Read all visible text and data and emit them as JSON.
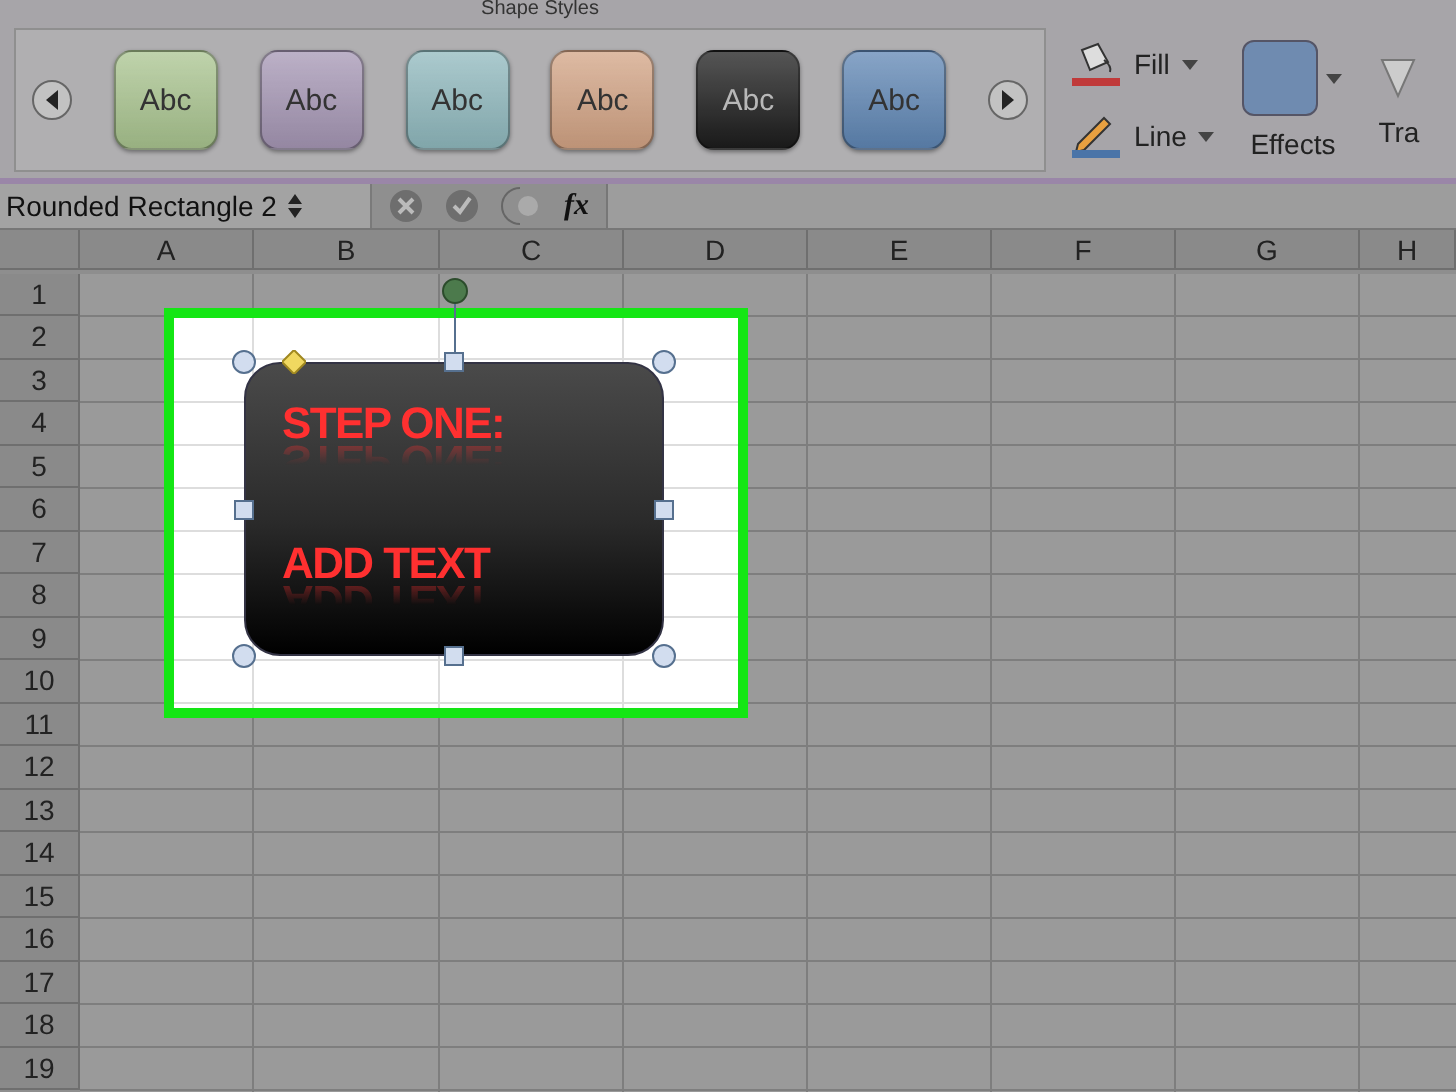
{
  "ribbon": {
    "group_title": "Shape Styles",
    "style_swatches": [
      {
        "label": "Abc",
        "color": "#a9c48f"
      },
      {
        "label": "Abc",
        "color": "#a596b4"
      },
      {
        "label": "Abc",
        "color": "#8fb8bd"
      },
      {
        "label": "Abc",
        "color": "#d2a384"
      },
      {
        "label": "Abc",
        "color": "#1c1c1c"
      },
      {
        "label": "Abc",
        "color": "#5f86b4"
      }
    ],
    "fill_label": "Fill",
    "line_label": "Line",
    "effects_label": "Effects",
    "cut_label": "Tra"
  },
  "formula_bar": {
    "name_box": "Rounded Rectangle 2",
    "fx": "fx"
  },
  "columns": [
    "A",
    "B",
    "C",
    "D",
    "E",
    "F",
    "G",
    "H"
  ],
  "rows": [
    "1",
    "2",
    "3",
    "4",
    "5",
    "6",
    "7",
    "8",
    "9",
    "10",
    "11",
    "12",
    "13",
    "14",
    "15",
    "16",
    "17",
    "18",
    "19"
  ],
  "shape": {
    "lines": [
      "STEP ONE:",
      "ADD TEXT"
    ]
  }
}
